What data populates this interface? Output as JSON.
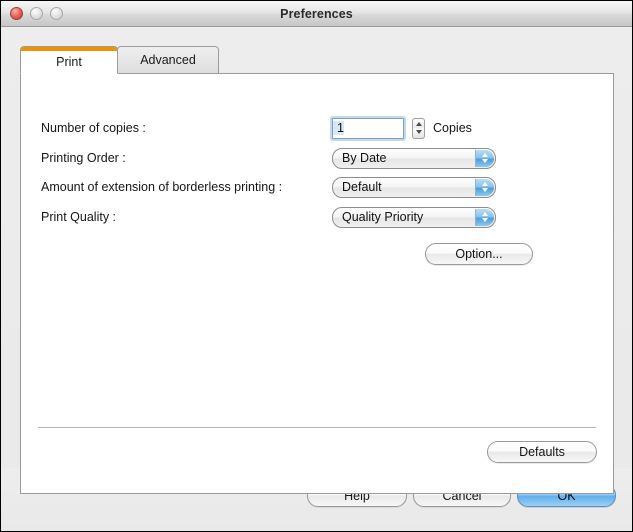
{
  "window": {
    "title": "Preferences",
    "controls": {
      "close": "close-button",
      "minimize": "minimize-button",
      "zoom": "zoom-button"
    }
  },
  "tabs": [
    {
      "label": "Print",
      "active": true
    },
    {
      "label": "Advanced",
      "active": false
    }
  ],
  "form": {
    "rows": [
      {
        "label": "Number of copies :",
        "value": "1",
        "suffix": "Copies",
        "type": "stepper-field"
      },
      {
        "label": "Printing Order :",
        "value": "By Date",
        "type": "popup"
      },
      {
        "label": "Amount of extension of borderless printing :",
        "value": "Default",
        "type": "popup"
      },
      {
        "label": "Print Quality :",
        "value": "Quality Priority",
        "type": "popup"
      }
    ],
    "option_button": "Option...",
    "defaults_button": "Defaults"
  },
  "dialog_buttons": {
    "help": "Help",
    "cancel": "Cancel",
    "ok": "OK"
  },
  "colors": {
    "active_tab_accent": "#F29100",
    "default_button": "#63AEEC",
    "popup_arrow_button": "#4E9FDB",
    "close_light": "#E8665C",
    "window_background": "#ECECEC"
  }
}
